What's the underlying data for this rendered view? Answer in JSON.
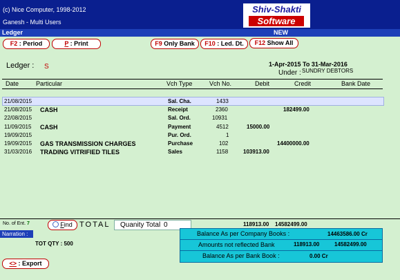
{
  "header": {
    "copyright": "(c) Nice Computer, 1998-2012",
    "user": "Ganesh - Multi Users",
    "logo_top": "Shiv-Shakti",
    "logo_bottom": "Software"
  },
  "subbar": {
    "title": "Ledger",
    "mode": "NEW"
  },
  "toolbar": {
    "period_key": "F2",
    "period_label": ": Period",
    "print_key": "P",
    "print_label": ": Print",
    "onlybank_key": "F9",
    "onlybank_label": "Only Bank",
    "leddt_key": "F10",
    "leddt_label": ": Led. Dt.",
    "showall_key": "F12",
    "showall_label": "Show All"
  },
  "ledger": {
    "label": "Ledger :",
    "value": "S",
    "period": "1-Apr-2015 To 31-Mar-2016",
    "under_label": "Under :",
    "under_value": "SUNDRY DEBTORS"
  },
  "table": {
    "columns": [
      "Date",
      "Particular",
      "Vch Type",
      "Vch No.",
      "Debit",
      "Credit",
      "Bank Date"
    ],
    "rows": [
      {
        "date": "21/08/2015",
        "particular": "",
        "vch_type": "Sal. Cha.",
        "vch_no": "1433",
        "debit": "",
        "credit": ""
      },
      {
        "date": "21/08/2015",
        "particular": "CASH",
        "vch_type": "Receipt",
        "vch_no": "2360",
        "debit": "",
        "credit": "182499.00"
      },
      {
        "date": "22/08/2015",
        "particular": "",
        "vch_type": "Sal. Ord.",
        "vch_no": "10931",
        "debit": "",
        "credit": ""
      },
      {
        "date": "11/09/2015",
        "particular": "CASH",
        "vch_type": "Payment",
        "vch_no": "4512",
        "debit": "15000.00",
        "credit": ""
      },
      {
        "date": "19/09/2015",
        "particular": "",
        "vch_type": "Pur. Ord.",
        "vch_no": "1",
        "debit": "",
        "credit": ""
      },
      {
        "date": "19/09/2015",
        "particular": "GAS TRANSMISSION CHARGES",
        "vch_type": "Purchase",
        "vch_no": "102",
        "debit": "",
        "credit": "14400000.00"
      },
      {
        "date": "31/03/2016",
        "particular": "TRADING VITRIFIED TILES",
        "vch_type": "Sales",
        "vch_no": "1158",
        "debit": "103913.00",
        "credit": ""
      }
    ]
  },
  "footer": {
    "entries_label": "No. of Ent.",
    "entries_value": "7",
    "find_prefix": "F",
    "find_rest": "ind",
    "total_label": "TOTAL",
    "qty_label": "Quanity Total",
    "qty_value": "0",
    "total_debit": "118913.00",
    "total_credit": "14582499.00",
    "narration_label": "Narration :",
    "tot_qty": "TOT QTY : 500",
    "export_key": "<>",
    "export_label": ": Export"
  },
  "balance": {
    "company_label": "Balance As per Company Books :",
    "company_value": "14463586.00 Cr",
    "not_reflected_label": "Amounts not reflected Bank",
    "not_reflected_debit": "118913.00",
    "not_reflected_credit": "14582499.00",
    "bank_label": "Balance As per Bank Book :",
    "bank_value": "0.00 Cr"
  },
  "colors": {
    "header_bg": "#0a1f8f",
    "subbar_bg": "#1d3fb8",
    "page_bg": "#d4f0d0",
    "accent_red": "#c00000",
    "balance_bg": "#17c6d8"
  }
}
